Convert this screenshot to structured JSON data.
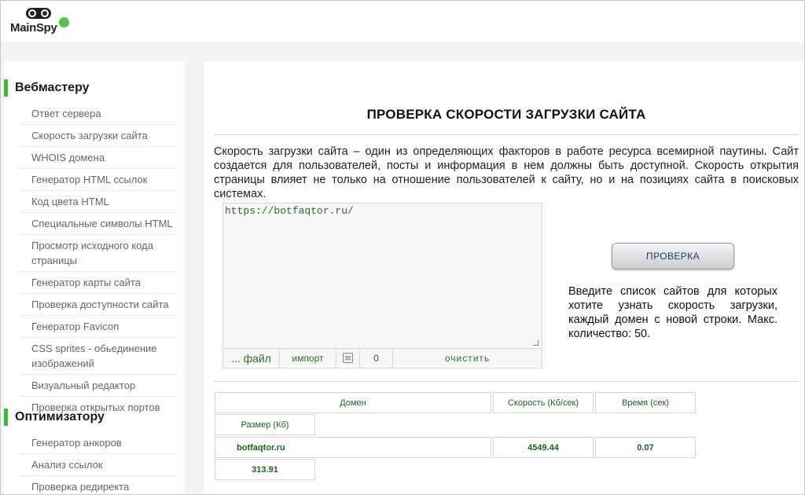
{
  "brand": {
    "name": "MainSpy",
    "badge_color": "#56c24c",
    "accent": "#3cba3c"
  },
  "sidebar": {
    "sections": [
      {
        "title": "Вебмастеру",
        "items": [
          "Ответ сервера",
          "Скорость загрузки сайта",
          "WHOIS домена",
          "Генератор HTML ссылок",
          "Код цвета HTML",
          "Специальные символы HTML",
          "Просмотр исходного кода страницы",
          "Генератор карты сайта",
          "Проверка доступности сайта",
          "Генератор Favicon",
          "CSS sprites - обьединение изображений",
          "Визуальный редактор",
          "Проверка открытых портов"
        ]
      },
      {
        "title": "Оптимизатору",
        "items": [
          "Генератор анкоров",
          "Анализ ссылок",
          "Проверка редиректа"
        ]
      }
    ]
  },
  "main": {
    "title": "ПРОВЕРКА СКОРОСТИ ЗАГРУЗКИ САЙТА",
    "description": "Скорость загрузки сайта – один из определяющих факторов в работе ресурса всемирной паутины. Сайт создается для пользователей, посты и информация в нем должны быть доступной. Скорость открытия страницы влияет не только на отношение пользователей к сайту, но и на позициях сайта в поисковых системах.",
    "textarea_value": "https://botfaqtor.ru/",
    "toolbar": {
      "file_label": "... файл",
      "import_label": "импорт",
      "list_icon": "list-icon",
      "count": "0",
      "clear_label": "очистить"
    },
    "check_button": "ПРОВЕРКА",
    "hint": "Введите список сайтов для которых хотите узнать скорость загрузки, каждый домен с новой строки. Макс. количество: 50."
  },
  "results": {
    "headers": {
      "domain": "Домен",
      "speed": "Скорость (Кб/сек)",
      "time": "Время (сек)",
      "size": "Размер (Кб)"
    },
    "rows": [
      {
        "domain": "botfaqtor.ru",
        "speed": "4549.44",
        "time": "0.07",
        "size": "313.91"
      }
    ]
  }
}
